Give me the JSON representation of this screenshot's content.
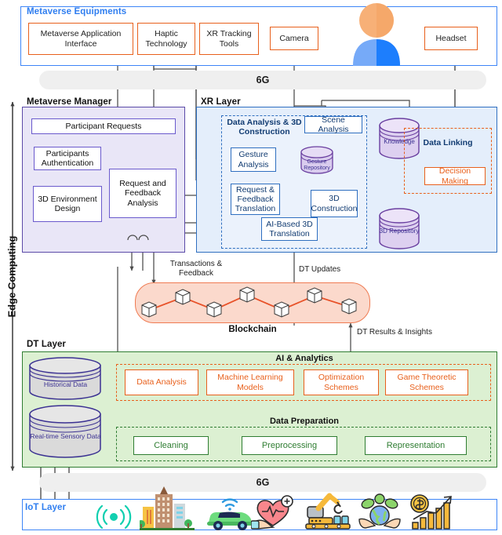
{
  "equipments": {
    "title": "Metaverse Equipments",
    "items": [
      {
        "label": "Metaverse Application Interface"
      },
      {
        "label": "Haptic Technology"
      },
      {
        "label": "XR Tracking Tools"
      },
      {
        "label": "Camera"
      },
      {
        "label": "Headset"
      }
    ],
    "avatar": "user-avatar-icon"
  },
  "bands": {
    "top_6g": "6G",
    "bottom_6g": "6G"
  },
  "edge": {
    "label": "Edge Computing"
  },
  "metaverse_manager": {
    "title": "Metaverse Manager",
    "nodes": [
      {
        "label": "Participant Requests"
      },
      {
        "label": "Participants Authentication"
      },
      {
        "label": "3D Environment Design"
      },
      {
        "label": "Request and Feedback Analysis"
      }
    ]
  },
  "xr_layer": {
    "title": "XR Layer",
    "group": {
      "title": "Data Analysis & 3D Construction",
      "nodes": [
        {
          "label": "Scene Analysis"
        },
        {
          "label": "Gesture Analysis"
        },
        {
          "label": "Request & Feedback Translation"
        },
        {
          "label": "3D Construction"
        },
        {
          "label": "AI-Based 3D Translation"
        }
      ],
      "repository": {
        "label": "Gesture Repository"
      }
    },
    "knowledge_db": {
      "label": "Knowledge"
    },
    "repository_3d": {
      "label": "3D Repository"
    },
    "data_linking": {
      "title": "Data Linking",
      "nodes": [
        {
          "label": "Decision Making"
        }
      ]
    }
  },
  "blockchain": {
    "label": "Blockchain",
    "in_label": "Transactions & Feedback",
    "dt_updates_label": "DT Updates",
    "dt_results_label": "DT Results & Insights",
    "block_count": 7
  },
  "dt_layer": {
    "title": "DT Layer",
    "databases": [
      {
        "label": "Historical Data"
      },
      {
        "label": "Real-time Sensory Data"
      }
    ],
    "ai_analytics": {
      "title": "AI & Analytics",
      "nodes": [
        {
          "label": "Data Analysis"
        },
        {
          "label": "Machine Learning Models"
        },
        {
          "label": "Optimization Schemes"
        },
        {
          "label": "Game Theoretic Schemes"
        }
      ]
    },
    "data_preparation": {
      "title": "Data Preparation",
      "nodes": [
        {
          "label": "Cleaning"
        },
        {
          "label": "Preprocessing"
        },
        {
          "label": "Representation"
        }
      ]
    }
  },
  "iot_layer": {
    "title": "IoT Layer",
    "icons": [
      {
        "name": "wireless-signal-icon"
      },
      {
        "name": "smart-city-buildings-icon"
      },
      {
        "name": "connected-car-icon"
      },
      {
        "name": "healthcare-heart-icon"
      },
      {
        "name": "industrial-robot-icon"
      },
      {
        "name": "smart-agriculture-icon"
      },
      {
        "name": "finance-growth-icon"
      }
    ]
  },
  "colors": {
    "blue_accent": "#3d85f7",
    "orange_accent": "#e8601c",
    "purple_accent": "#5b4aa8",
    "green_accent": "#2f7d32",
    "xr_blue": "#2f6fc0",
    "band_gray": "#efefef"
  }
}
